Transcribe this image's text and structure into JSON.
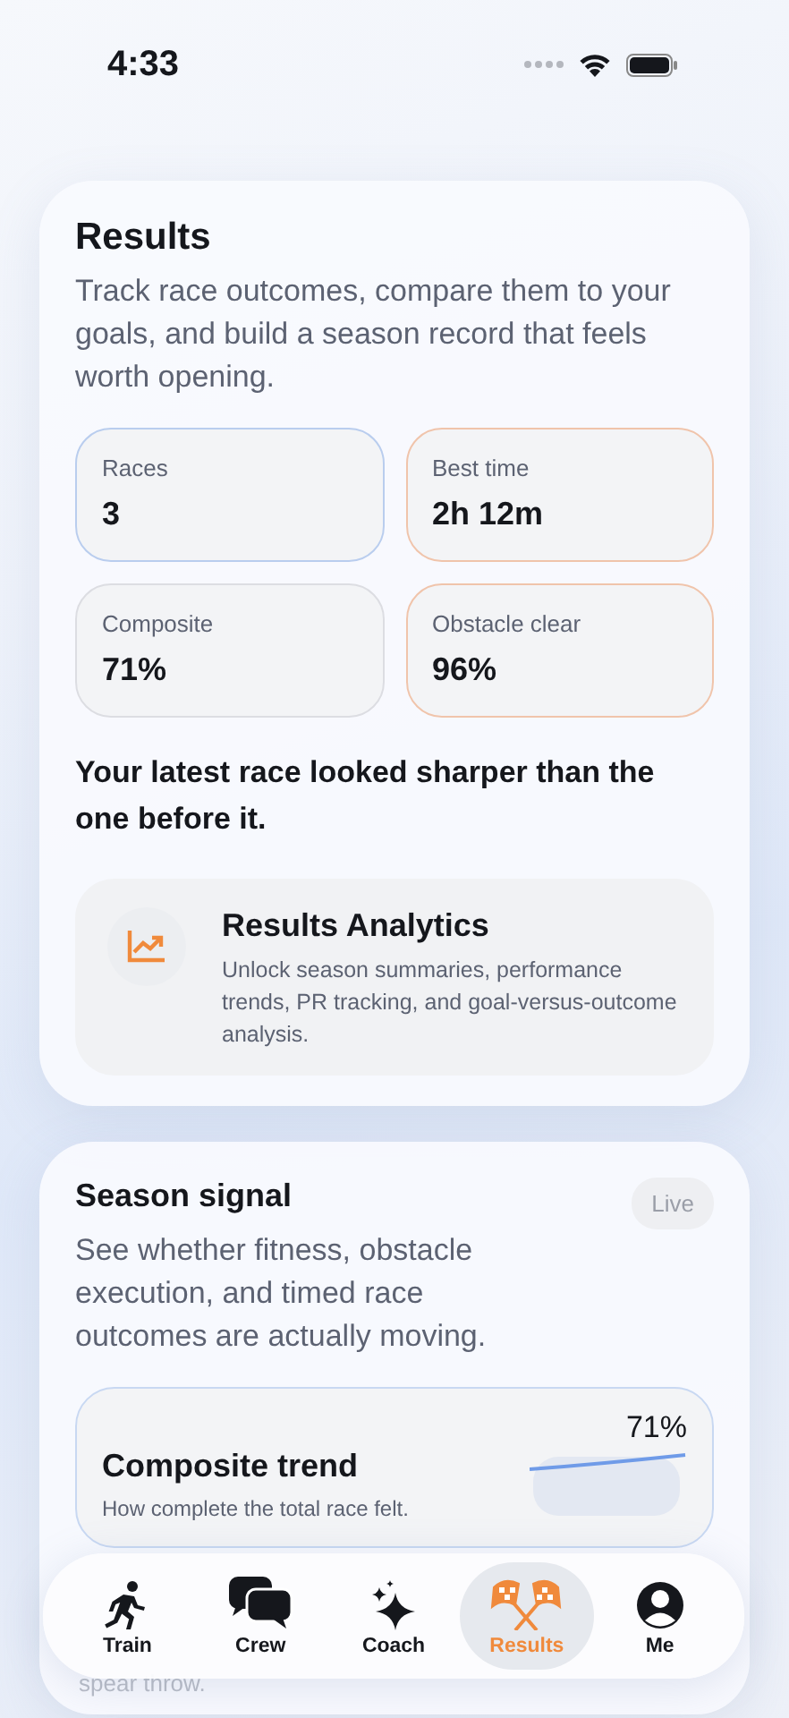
{
  "status_bar": {
    "time": "4:33"
  },
  "results": {
    "title": "Results",
    "description": "Track race outcomes, compare them to your goals, and build a season record that feels worth opening.",
    "stats": [
      {
        "label": "Races",
        "value": "3",
        "color": "#b9cdee"
      },
      {
        "label": "Best time",
        "value": "2h 12m",
        "color": "#f0c4ab"
      },
      {
        "label": "Composite",
        "value": "71%",
        "color": "#dcdde2"
      },
      {
        "label": "Obstacle clear",
        "value": "96%",
        "color": "#f0c4ab"
      }
    ],
    "insight": "Your latest race looked sharper than the one before it.",
    "promo": {
      "title": "Results Analytics",
      "description": "Unlock season summaries, performance trends, PR tracking, and goal-versus-outcome analysis."
    }
  },
  "season_signal": {
    "title": "Season signal",
    "badge": "Live",
    "description": "See whether fitness, obstacle execution, and timed race outcomes are actually moving.",
    "trend": {
      "title": "Composite trend",
      "subtitle": "How complete the total race felt.",
      "value": "71%"
    },
    "next_row_text": "spear throw."
  },
  "tab_bar": [
    {
      "label": "Train",
      "selected": false
    },
    {
      "label": "Crew",
      "selected": false
    },
    {
      "label": "Coach",
      "selected": false
    },
    {
      "label": "Results",
      "selected": true
    },
    {
      "label": "Me",
      "selected": false
    }
  ]
}
